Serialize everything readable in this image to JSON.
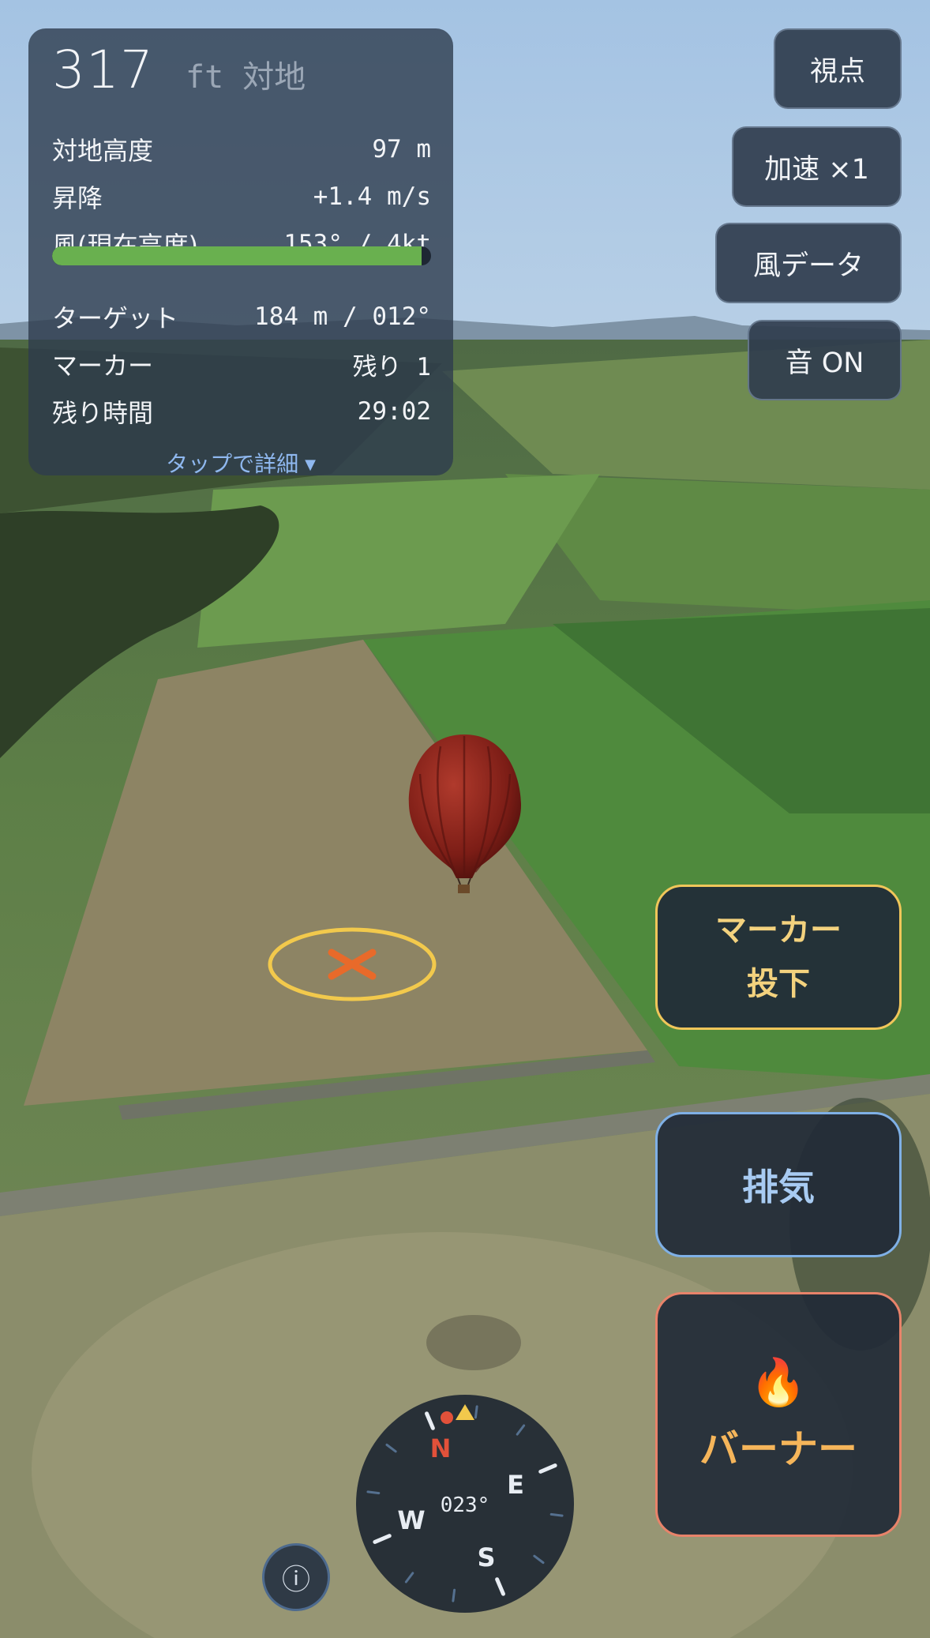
{
  "hud": {
    "altitude_value": "317",
    "altitude_unit": "ft 対地",
    "rows": [
      {
        "label": "対地高度",
        "value": "97 m"
      },
      {
        "label": "昇降",
        "value": "+1.4 m/s"
      },
      {
        "label": "風(現在高度)",
        "value": "153° / 4kt"
      }
    ],
    "fuel_fraction": 0.975,
    "rows2": [
      {
        "label": "ターゲット",
        "value": "184 m / 012°"
      },
      {
        "label": "マーカー",
        "value": "残り 1"
      },
      {
        "label": "残り時間",
        "value": "29:02"
      }
    ],
    "detail_label": "タップで詳細",
    "detail_arrow": "▼"
  },
  "top_buttons": {
    "view": "視点",
    "speed": "加速 ×1",
    "wind": "風データ",
    "sound": "音 ON"
  },
  "actions": {
    "marker_line1": "マーカー",
    "marker_line2": "投下",
    "vent": "排気",
    "burner_icon": "🔥",
    "burner": "バーナー"
  },
  "compass": {
    "heading": "023°",
    "n": "N",
    "e": "E",
    "s": "S",
    "w": "W"
  },
  "info_icon": "ⓘ",
  "colors": {
    "accent_yellow": "#f0c65a",
    "accent_blue": "#7fb0e6",
    "accent_orange": "#e8836a",
    "fuel_green": "#69b04f",
    "north_red": "#e2513a"
  }
}
